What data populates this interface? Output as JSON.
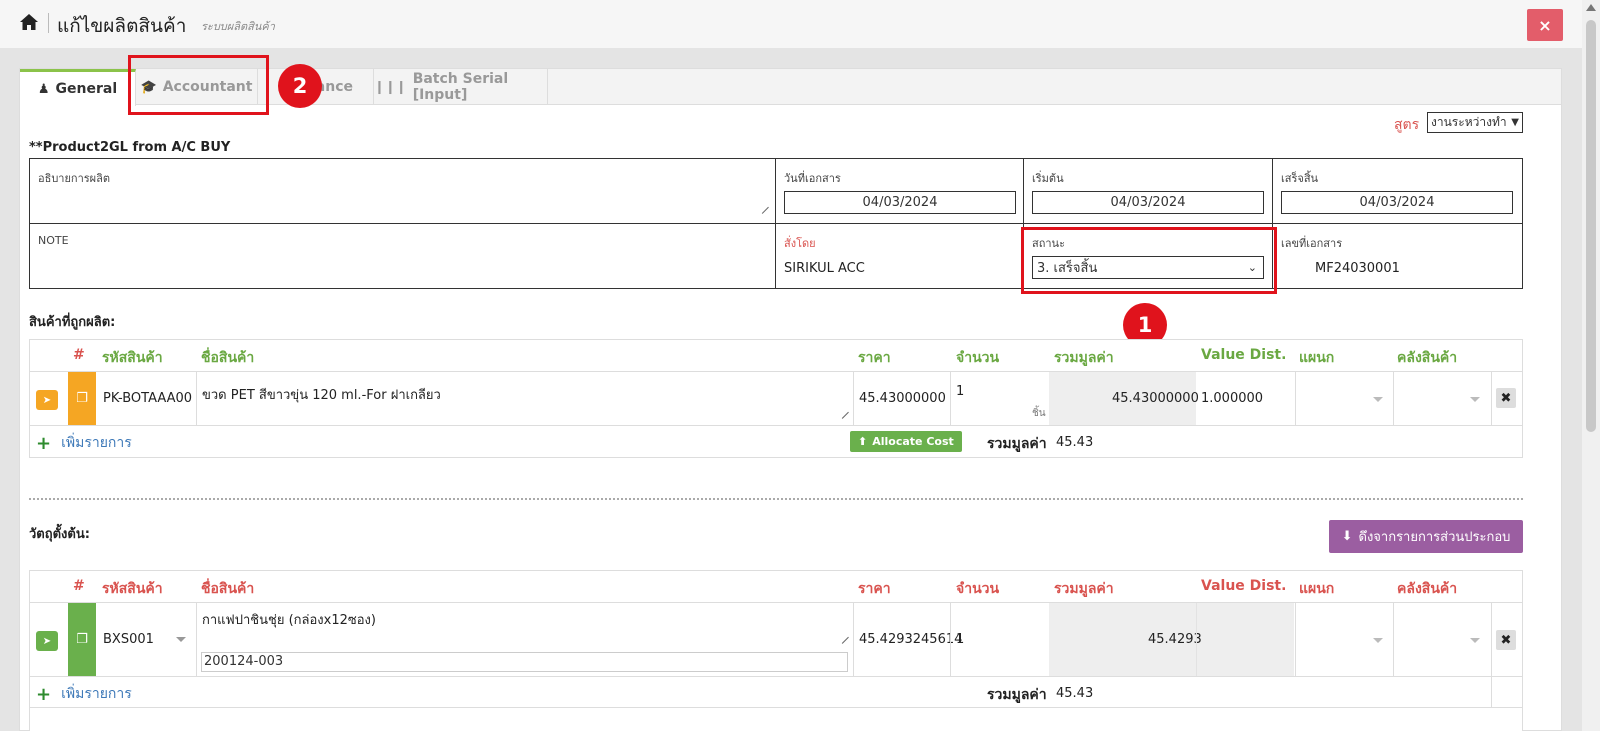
{
  "header": {
    "title": "แก้ไขผลิตสินค้า",
    "subtitle": "ระบบผลิตสินค้า",
    "close_label": "×"
  },
  "tabs": [
    {
      "label": "General",
      "icon": "user-icon",
      "active": true
    },
    {
      "label": "Accountant",
      "icon": "graduation-cap-icon",
      "active": false
    },
    {
      "label": "ance",
      "icon": "",
      "active": false
    },
    {
      "label": "Batch Serial [Input]",
      "icon": "barcode-icon",
      "active": false
    }
  ],
  "annotations": {
    "marker_1": "1",
    "marker_2": "2"
  },
  "formula": {
    "label": "สูตร",
    "selected": "งานระหว่างทำ"
  },
  "doc_title": "**Product2GL from A/C BUY",
  "form": {
    "description_label": "อธิบายการผลิต",
    "doc_date_label": "วันที่เอกสาร",
    "doc_date": "04/03/2024",
    "start_label": "เริ่มต้น",
    "start_date": "04/03/2024",
    "finish_label": "เสร็จสิ้น",
    "finish_date": "04/03/2024",
    "note_label": "NOTE",
    "ordered_by_label": "สั่งโดย",
    "ordered_by": "SIRIKUL ACC",
    "status_label": "สถานะ",
    "status": "3. เสร็จสิ้น",
    "doc_no_label": "เลขที่เอกสาร",
    "doc_no": "MF24030001"
  },
  "produced": {
    "section_title": "สินค้าที่ถูกผลิต:",
    "headers": {
      "num": "#",
      "code": "รหัสสินค้า",
      "name": "ชื่อสินค้า",
      "price": "ราคา",
      "qty": "จำนวน",
      "total": "รวมมูลค่า",
      "value_dist": "Value Dist.",
      "dept": "แผนก",
      "warehouse": "คลังสินค้า"
    },
    "row": {
      "code": "PK-BOTAAA00",
      "name": "ขวด PET สีขาวขุ่น 120 ml.-For ฝาเกลียว",
      "price": "45.43000000",
      "qty": "1",
      "unit": "ชิ้น",
      "total": "45.43000000",
      "value_dist": "1.000000"
    },
    "add_label": "เพิ่มรายการ",
    "allocate_label": "Allocate Cost",
    "sum_label": "รวมมูลค่า",
    "sum_value": "45.43"
  },
  "materials": {
    "section_title": "วัตถุตั้งต้น:",
    "pull_label": "ดึงจากรายการส่วนประกอบ",
    "headers": {
      "num": "#",
      "code": "รหัสสินค้า",
      "name": "ชื่อสินค้า",
      "price": "ราคา",
      "qty": "จำนวน",
      "total": "รวมมูลค่า",
      "value_dist": "Value Dist.",
      "dept": "แผนก",
      "warehouse": "คลังสินค้า"
    },
    "row": {
      "code": "BXS001",
      "name": "กาแฟปาชินชุ่ย (กล่องx12ซอง)",
      "lot": "200124-003",
      "price": "45.4293245614",
      "qty": "1",
      "total": "45.4293"
    },
    "add_label": "เพิ่มรายการ",
    "sum_label": "รวมมูลค่า",
    "sum_value": "45.43"
  },
  "colors": {
    "accent_green": "#6aa842",
    "danger": "#e0131c",
    "orange": "#f5a623",
    "purple": "#9b5ea1"
  }
}
